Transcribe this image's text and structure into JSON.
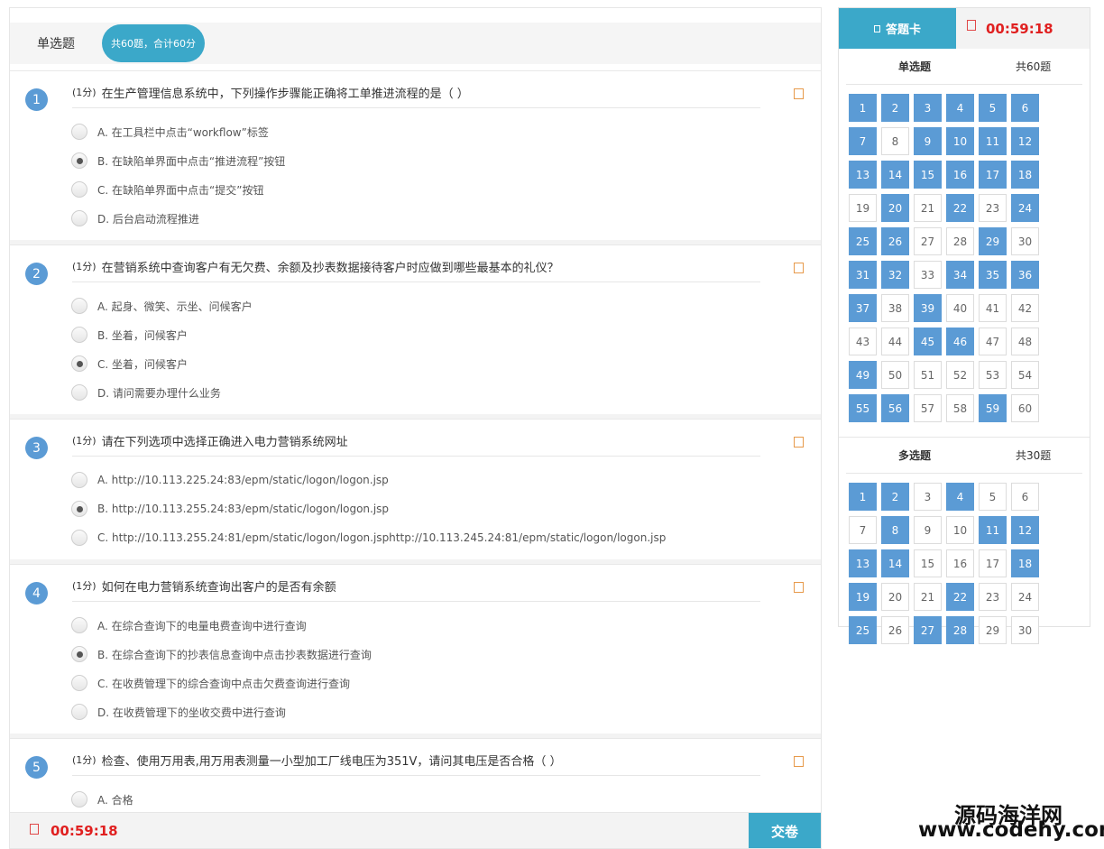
{
  "header": {
    "type_label": "单选题",
    "type_pill": "共60题，合计60分"
  },
  "questions": [
    {
      "num": "1",
      "score": "(1分)",
      "text": "在生产管理信息系统中，下列操作步骤能正确将工单推进流程的是（   ）",
      "options": [
        {
          "label": "A. 在工具栏中点击“workflow”标签",
          "selected": false
        },
        {
          "label": "B. 在缺陷单界面中点击“推进流程”按钮",
          "selected": true
        },
        {
          "label": "C. 在缺陷单界面中点击“提交”按钮",
          "selected": false
        },
        {
          "label": "D. 后台启动流程推进",
          "selected": false
        }
      ]
    },
    {
      "num": "2",
      "score": "(1分)",
      "text": "在营销系统中查询客户有无欠费、余额及抄表数据接待客户时应做到哪些最基本的礼仪？",
      "options": [
        {
          "label": "A. 起身、微笑、示坐、问候客户",
          "selected": false
        },
        {
          "label": "B. 坐着，问候客户",
          "selected": false
        },
        {
          "label": "C. 坐着，问候客户",
          "selected": true
        },
        {
          "label": "D. 请问需要办理什么业务",
          "selected": false
        }
      ]
    },
    {
      "num": "3",
      "score": "(1分)",
      "text": "请在下列选项中选择正确进入电力营销系统网址",
      "options": [
        {
          "label": "A. http://10.113.225.24:83/epm/static/logon/logon.jsp",
          "selected": false
        },
        {
          "label": "B. http://10.113.255.24:83/epm/static/logon/logon.jsp",
          "selected": true
        },
        {
          "label": "C. http://10.113.255.24:81/epm/static/logon/logon.jsphttp://10.113.245.24:81/epm/static/logon/logon.jsp",
          "selected": false
        }
      ]
    },
    {
      "num": "4",
      "score": "(1分)",
      "text": "如何在电力营销系统查询出客户的是否有余额",
      "options": [
        {
          "label": "A. 在综合查询下的电量电费查询中进行查询",
          "selected": false
        },
        {
          "label": "B. 在综合查询下的抄表信息查询中点击抄表数据进行查询",
          "selected": true
        },
        {
          "label": "C. 在收费管理下的综合查询中点击欠费查询进行查询",
          "selected": false
        },
        {
          "label": "D. 在收费管理下的坐收交费中进行查询",
          "selected": false
        }
      ]
    },
    {
      "num": "5",
      "score": "(1分)",
      "text": "检查、使用万用表,用万用表测量一小型加工厂线电压为351V，请问其电压是否合格（   ）",
      "options": [
        {
          "label": "A. 合格",
          "selected": false
        }
      ]
    }
  ],
  "footer": {
    "timer": "00:59:18",
    "submit_label": "交卷"
  },
  "card": {
    "tab_label": "答题卡",
    "timer": "00:59:18",
    "sections": [
      {
        "title": "单选题",
        "count": "共60题",
        "cells": [
          {
            "n": "1",
            "done": true
          },
          {
            "n": "2",
            "done": true
          },
          {
            "n": "3",
            "done": true
          },
          {
            "n": "4",
            "done": true
          },
          {
            "n": "5",
            "done": true
          },
          {
            "n": "6",
            "done": true
          },
          {
            "n": "7",
            "done": true
          },
          {
            "n": "8",
            "done": false
          },
          {
            "n": "9",
            "done": true
          },
          {
            "n": "10",
            "done": true
          },
          {
            "n": "11",
            "done": true
          },
          {
            "n": "12",
            "done": true
          },
          {
            "n": "13",
            "done": true
          },
          {
            "n": "14",
            "done": true
          },
          {
            "n": "15",
            "done": true
          },
          {
            "n": "16",
            "done": true
          },
          {
            "n": "17",
            "done": true
          },
          {
            "n": "18",
            "done": true
          },
          {
            "n": "19",
            "done": false
          },
          {
            "n": "20",
            "done": true
          },
          {
            "n": "21",
            "done": false
          },
          {
            "n": "22",
            "done": true
          },
          {
            "n": "23",
            "done": false
          },
          {
            "n": "24",
            "done": true
          },
          {
            "n": "25",
            "done": true
          },
          {
            "n": "26",
            "done": true
          },
          {
            "n": "27",
            "done": false
          },
          {
            "n": "28",
            "done": false
          },
          {
            "n": "29",
            "done": true
          },
          {
            "n": "30",
            "done": false
          },
          {
            "n": "31",
            "done": true
          },
          {
            "n": "32",
            "done": true
          },
          {
            "n": "33",
            "done": false
          },
          {
            "n": "34",
            "done": true
          },
          {
            "n": "35",
            "done": true
          },
          {
            "n": "36",
            "done": true
          },
          {
            "n": "37",
            "done": true
          },
          {
            "n": "38",
            "done": false
          },
          {
            "n": "39",
            "done": true
          },
          {
            "n": "40",
            "done": false
          },
          {
            "n": "41",
            "done": false
          },
          {
            "n": "42",
            "done": false
          },
          {
            "n": "43",
            "done": false
          },
          {
            "n": "44",
            "done": false
          },
          {
            "n": "45",
            "done": true
          },
          {
            "n": "46",
            "done": true
          },
          {
            "n": "47",
            "done": false
          },
          {
            "n": "48",
            "done": false
          },
          {
            "n": "49",
            "done": true
          },
          {
            "n": "50",
            "done": false
          },
          {
            "n": "51",
            "done": false
          },
          {
            "n": "52",
            "done": false
          },
          {
            "n": "53",
            "done": false
          },
          {
            "n": "54",
            "done": false
          },
          {
            "n": "55",
            "done": true
          },
          {
            "n": "56",
            "done": true
          },
          {
            "n": "57",
            "done": false
          },
          {
            "n": "58",
            "done": false
          },
          {
            "n": "59",
            "done": true
          },
          {
            "n": "60",
            "done": false
          }
        ]
      },
      {
        "title": "多选题",
        "count": "共30题",
        "cells": [
          {
            "n": "1",
            "done": true
          },
          {
            "n": "2",
            "done": true
          },
          {
            "n": "3",
            "done": false
          },
          {
            "n": "4",
            "done": true
          },
          {
            "n": "5",
            "done": false
          },
          {
            "n": "6",
            "done": false
          },
          {
            "n": "7",
            "done": false
          },
          {
            "n": "8",
            "done": true
          },
          {
            "n": "9",
            "done": false
          },
          {
            "n": "10",
            "done": false
          },
          {
            "n": "11",
            "done": true
          },
          {
            "n": "12",
            "done": true
          },
          {
            "n": "13",
            "done": true
          },
          {
            "n": "14",
            "done": true
          },
          {
            "n": "15",
            "done": false
          },
          {
            "n": "16",
            "done": false
          },
          {
            "n": "17",
            "done": false
          },
          {
            "n": "18",
            "done": true
          },
          {
            "n": "19",
            "done": true
          },
          {
            "n": "20",
            "done": false
          },
          {
            "n": "21",
            "done": false
          },
          {
            "n": "22",
            "done": true
          },
          {
            "n": "23",
            "done": false
          },
          {
            "n": "24",
            "done": false
          },
          {
            "n": "25",
            "done": true
          },
          {
            "n": "26",
            "done": false
          },
          {
            "n": "27",
            "done": true
          },
          {
            "n": "28",
            "done": true
          },
          {
            "n": "29",
            "done": false
          },
          {
            "n": "30",
            "done": false
          }
        ]
      }
    ]
  },
  "watermark": {
    "line1": "源码海洋网",
    "line2": "www.codehy.com"
  }
}
